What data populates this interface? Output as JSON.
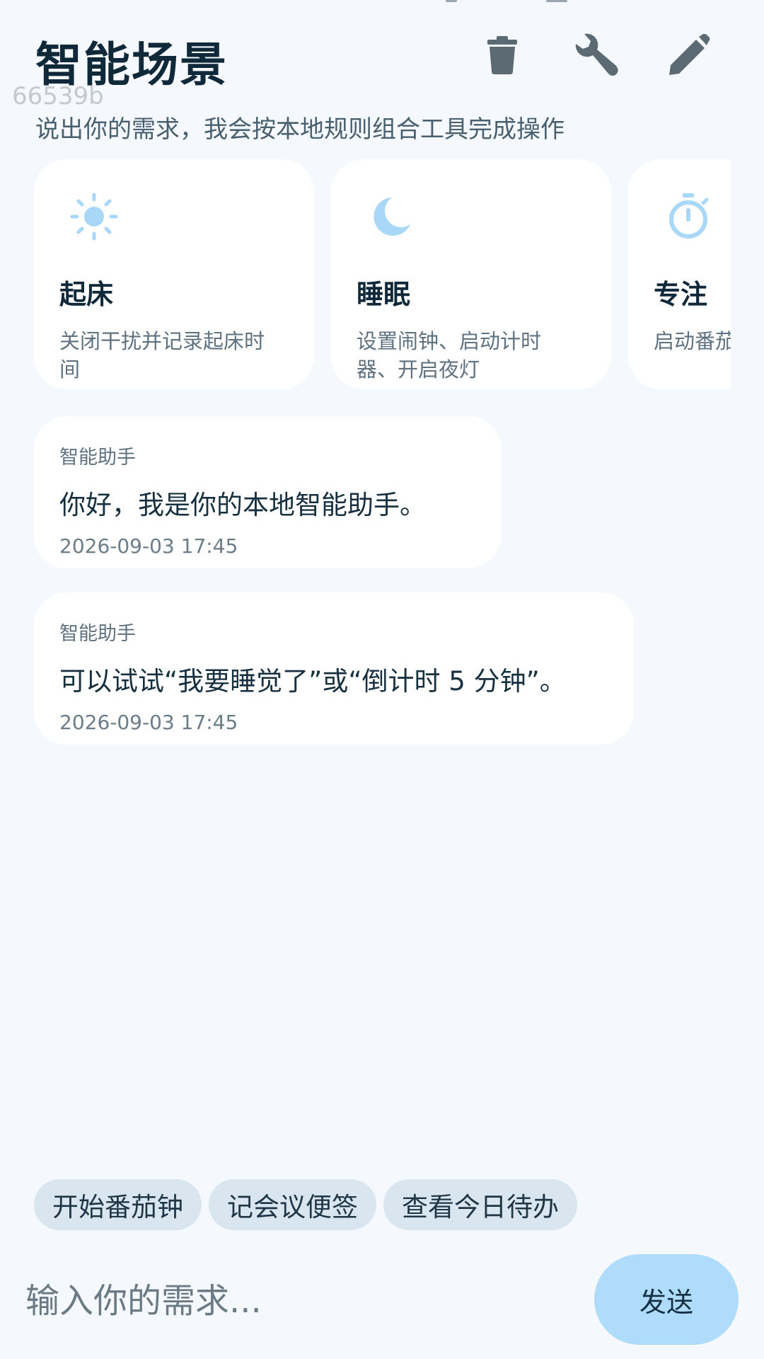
{
  "header": {
    "title": "智能场景",
    "build_tag": "66539b",
    "subtitle": "说出你的需求，我会按本地规则组合工具完成操作",
    "actions": [
      {
        "icon": "trash-icon",
        "label": "delete"
      },
      {
        "icon": "wrench-icon",
        "label": "tools"
      },
      {
        "icon": "pencil-icon",
        "label": "edit"
      }
    ]
  },
  "scenes": [
    {
      "icon": "sun-icon",
      "title": "起床",
      "desc": "关闭干扰并记录起床时间"
    },
    {
      "icon": "moon-icon",
      "title": "睡眠",
      "desc": "设置闹钟、启动计时器、开启夜灯"
    },
    {
      "icon": "timer-icon",
      "title": "专注",
      "desc": "启动番茄钟专注完成"
    }
  ],
  "messages": [
    {
      "sender": "智能助手",
      "text": "你好，我是你的本地智能助手。",
      "time": "2026-09-03 17:45"
    },
    {
      "sender": "智能助手",
      "text": "可以试试“我要睡觉了”或“倒计时 5 分钟”。",
      "time": "2026-09-03 17:45"
    }
  ],
  "quick_actions": [
    {
      "label": "开始番茄钟"
    },
    {
      "label": "记会议便签"
    },
    {
      "label": "查看今日待办"
    }
  ],
  "composer": {
    "placeholder": "输入你的需求...",
    "value": "",
    "send_label": "发送"
  },
  "colors": {
    "background": "#f5f9fd",
    "card": "#ffffff",
    "accent": "#b0dcfb",
    "icon_accent": "#a9d7f8",
    "chip": "#d9e6ef",
    "toolbar_icon": "#5c6a74"
  }
}
